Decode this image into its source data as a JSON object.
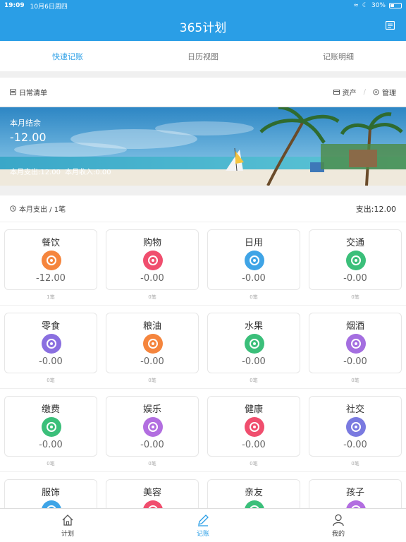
{
  "status_bar": {
    "time": "19:09",
    "date": "10月6日周四",
    "battery": "30%"
  },
  "header": {
    "title": "365计划",
    "menu_icon": "notebook-icon"
  },
  "tabs": [
    {
      "label": "快速记账",
      "active": true
    },
    {
      "label": "日历视图",
      "active": false
    },
    {
      "label": "记账明细",
      "active": false
    }
  ],
  "list_header": {
    "title": "日常清单",
    "assets": "资产",
    "manage": "管理"
  },
  "banner": {
    "label": "本月结余",
    "amount": "-12.00",
    "expense": "本月支出:12.00",
    "income": "本月收入:0.00"
  },
  "summary": {
    "left": "本月支出 / 1笔",
    "right": "支出:12.00"
  },
  "categories": [
    {
      "name": "餐饮",
      "amount": "-12.00",
      "count": "1笔",
      "color": "#f5853d",
      "icon": "fork-knife-icon"
    },
    {
      "name": "购物",
      "amount": "-0.00",
      "count": "0笔",
      "color": "#f04e6e",
      "icon": "shopping-bag-icon"
    },
    {
      "name": "日用",
      "amount": "-0.00",
      "count": "0笔",
      "color": "#3fa4e6",
      "icon": "daily-goods-icon"
    },
    {
      "name": "交通",
      "amount": "-0.00",
      "count": "0笔",
      "color": "#3bbf7a",
      "icon": "bus-icon"
    },
    {
      "name": "零食",
      "amount": "-0.00",
      "count": "0笔",
      "color": "#8a6fe0",
      "icon": "cupcake-icon"
    },
    {
      "name": "粮油",
      "amount": "-0.00",
      "count": "0笔",
      "color": "#f5853d",
      "icon": "rice-bag-icon"
    },
    {
      "name": "水果",
      "amount": "-0.00",
      "count": "0笔",
      "color": "#3bbf7a",
      "icon": "apple-icon"
    },
    {
      "name": "烟酒",
      "amount": "-0.00",
      "count": "0笔",
      "color": "#a46ee0",
      "icon": "wine-bottle-icon"
    },
    {
      "name": "缴费",
      "amount": "-0.00",
      "count": "0笔",
      "color": "#3bbf7a",
      "icon": "bill-check-icon"
    },
    {
      "name": "娱乐",
      "amount": "-0.00",
      "count": "0笔",
      "color": "#b26ee0",
      "icon": "balloon-icon"
    },
    {
      "name": "健康",
      "amount": "-0.00",
      "count": "0笔",
      "color": "#f04e6e",
      "icon": "heart-icon"
    },
    {
      "name": "社交",
      "amount": "-0.00",
      "count": "0笔",
      "color": "#7a7ae0",
      "icon": "people-icon"
    },
    {
      "name": "服饰",
      "amount": "",
      "count": "",
      "color": "#3fa4e6",
      "icon": "shirt-icon"
    },
    {
      "name": "美容",
      "amount": "",
      "count": "",
      "color": "#f04e6e",
      "icon": "beauty-icon"
    },
    {
      "name": "亲友",
      "amount": "",
      "count": "",
      "color": "#3bbf7a",
      "icon": "friends-icon"
    },
    {
      "name": "孩子",
      "amount": "",
      "count": "",
      "color": "#b26ee0",
      "icon": "child-icon"
    }
  ],
  "bottom_nav": [
    {
      "label": "计划",
      "icon": "home-icon",
      "active": false
    },
    {
      "label": "记账",
      "icon": "pencil-icon",
      "active": true
    },
    {
      "label": "我的",
      "icon": "user-icon",
      "active": false
    }
  ]
}
